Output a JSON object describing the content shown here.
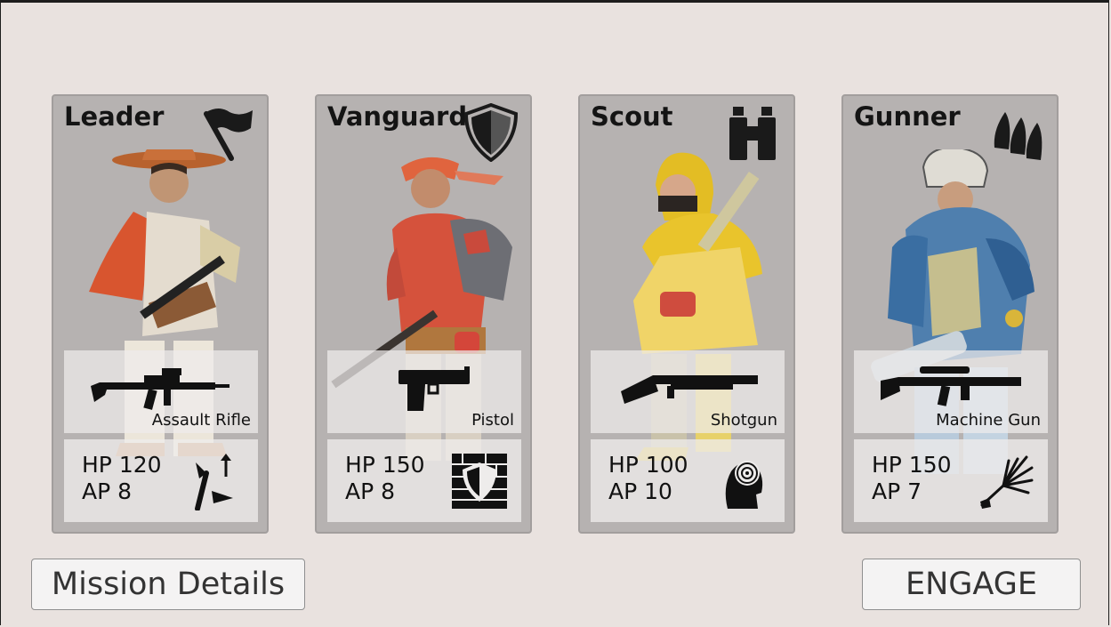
{
  "cards": [
    {
      "name": "Leader",
      "role_icon": "flag-icon",
      "weapon": "Assault Rifle",
      "weapon_icon": "assault-rifle-icon",
      "hp": "HP 120",
      "ap": "AP 8",
      "ability_icon": "rally-flag-icon",
      "palette": {
        "cloak": "#d8552f",
        "hat": "#c9703a",
        "body": "#e4dccf"
      }
    },
    {
      "name": "Vanguard",
      "role_icon": "shield-icon",
      "weapon": "Pistol",
      "weapon_icon": "pistol-icon",
      "hp": "HP 150",
      "ap": "AP 8",
      "ability_icon": "shield-wall-icon",
      "palette": {
        "cloak": "#d5523c",
        "hat": "#e0643e",
        "body": "#6d6e74"
      }
    },
    {
      "name": "Scout",
      "role_icon": "binoculars-icon",
      "weapon": "Shotgun",
      "weapon_icon": "shotgun-icon",
      "hp": "HP 100",
      "ap": "AP 10",
      "ability_icon": "target-head-icon",
      "palette": {
        "cloak": "#e9c42c",
        "hat": "#e3bd24",
        "body": "#f0d468"
      }
    },
    {
      "name": "Gunner",
      "role_icon": "bullets-icon",
      "weapon": "Machine Gun",
      "weapon_icon": "machine-gun-icon",
      "hp": "HP 150",
      "ap": "AP 7",
      "ability_icon": "suppression-burst-icon",
      "palette": {
        "cloak": "#4f7fae",
        "hat": "#dfdcd4",
        "body": "#3a6ea2"
      }
    }
  ],
  "buttons": {
    "mission_details": "Mission Details",
    "engage": "ENGAGE"
  }
}
